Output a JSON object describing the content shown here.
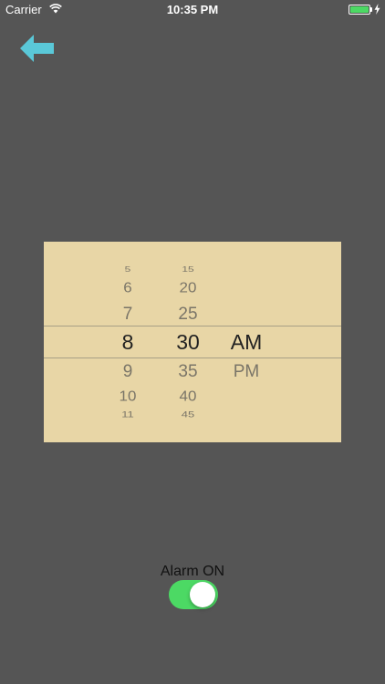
{
  "status_bar": {
    "carrier": "Carrier",
    "time": "10:35 PM",
    "wifi_icon": "wifi-icon",
    "battery_icon": "battery-icon",
    "charging_icon": "bolt-icon"
  },
  "nav": {
    "back_icon": "arrow-left-icon",
    "back_color": "#5ac8d8"
  },
  "picker": {
    "hours": [
      "5",
      "6",
      "7",
      "8",
      "9",
      "10",
      "11"
    ],
    "minutes": [
      "15",
      "20",
      "25",
      "30",
      "35",
      "40",
      "45"
    ],
    "periods": [
      "AM",
      "PM"
    ],
    "selected": {
      "hour": "8",
      "minute": "30",
      "period": "AM"
    },
    "background": "#e8d6a6"
  },
  "alarm": {
    "label": "Alarm ON",
    "enabled": true,
    "toggle_color": "#4cd964"
  }
}
